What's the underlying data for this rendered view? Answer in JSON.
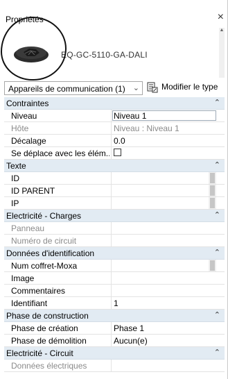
{
  "panel": {
    "title": "Propriétés",
    "close_glyph": "×"
  },
  "type_selector": {
    "name": "EQ-GC-5110-GA-DALI",
    "icon": "device-image-icon"
  },
  "instance_filter": {
    "value": "Appareils de communication (1)",
    "chevron": "⌄"
  },
  "edit_type": {
    "label": "Modifier le type",
    "icon": "edit-type-icon"
  },
  "groups": [
    {
      "label": "Contraintes",
      "caret": "⌃",
      "rows": [
        {
          "name": "Niveau",
          "value": "Niveau 1",
          "active": true
        },
        {
          "name": "Hôte",
          "value": "Niveau : Niveau 1",
          "dim": true
        },
        {
          "name": "Décalage",
          "value": "0.0"
        },
        {
          "name": "Se déplace avec les élém...",
          "value": "",
          "checkbox": true
        }
      ]
    },
    {
      "label": "Texte",
      "caret": "⌃",
      "rows": [
        {
          "name": "ID",
          "value": "",
          "scroll": true
        },
        {
          "name": "ID PARENT",
          "value": "",
          "scroll": true
        },
        {
          "name": "IP",
          "value": "",
          "scroll": true
        }
      ]
    },
    {
      "label": "Electricité - Charges",
      "caret": "⌃",
      "rows": [
        {
          "name": "Panneau",
          "value": "",
          "dim": true
        },
        {
          "name": "Numéro de circuit",
          "value": "",
          "dim": true
        }
      ]
    },
    {
      "label": "Données d'identification",
      "caret": "⌃",
      "rows": [
        {
          "name": "Num coffret-Moxa",
          "value": "",
          "scroll": true
        },
        {
          "name": "Image",
          "value": ""
        },
        {
          "name": "Commentaires",
          "value": ""
        },
        {
          "name": "Identifiant",
          "value": "1"
        }
      ]
    },
    {
      "label": "Phase de construction",
      "caret": "⌃",
      "rows": [
        {
          "name": "Phase de création",
          "value": "Phase 1"
        },
        {
          "name": "Phase de démolition",
          "value": "Aucun(e)"
        }
      ]
    },
    {
      "label": "Electricité - Circuit",
      "caret": "⌃",
      "rows": [
        {
          "name": "Données électriques",
          "value": "",
          "dim": true
        }
      ]
    }
  ]
}
